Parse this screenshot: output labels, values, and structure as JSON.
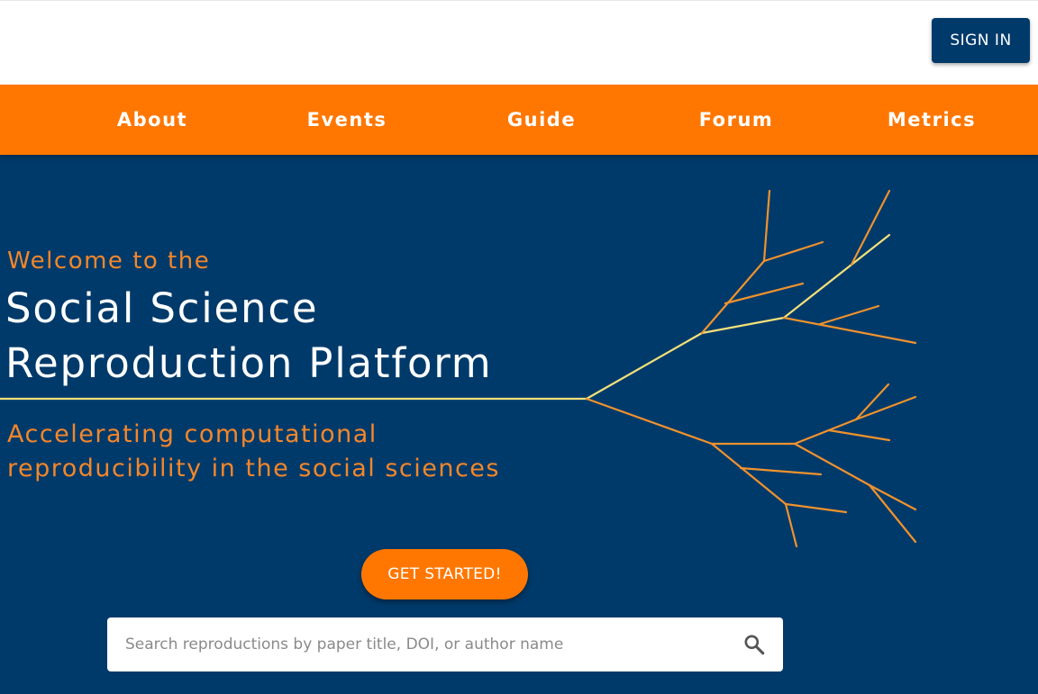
{
  "header": {
    "signin_label": "SIGN IN"
  },
  "nav": {
    "items": [
      {
        "label": "About"
      },
      {
        "label": "Events"
      },
      {
        "label": "Guide"
      },
      {
        "label": "Forum"
      },
      {
        "label": "Metrics"
      }
    ]
  },
  "hero": {
    "welcome": "Welcome to the",
    "title_line1": "Social Science",
    "title_line2": "Reproduction Platform",
    "subtitle_line1": "Accelerating computational",
    "subtitle_line2": "reproducibility in the social sciences",
    "cta_label": "GET STARTED!"
  },
  "search": {
    "placeholder": "Search reproductions by paper title, DOI, or author name",
    "icon": "search-icon"
  },
  "colors": {
    "navy": "#003a6a",
    "orange": "#ff7700",
    "accent_orange": "#f4862a",
    "highlight_yellow": "#f2e07a"
  }
}
